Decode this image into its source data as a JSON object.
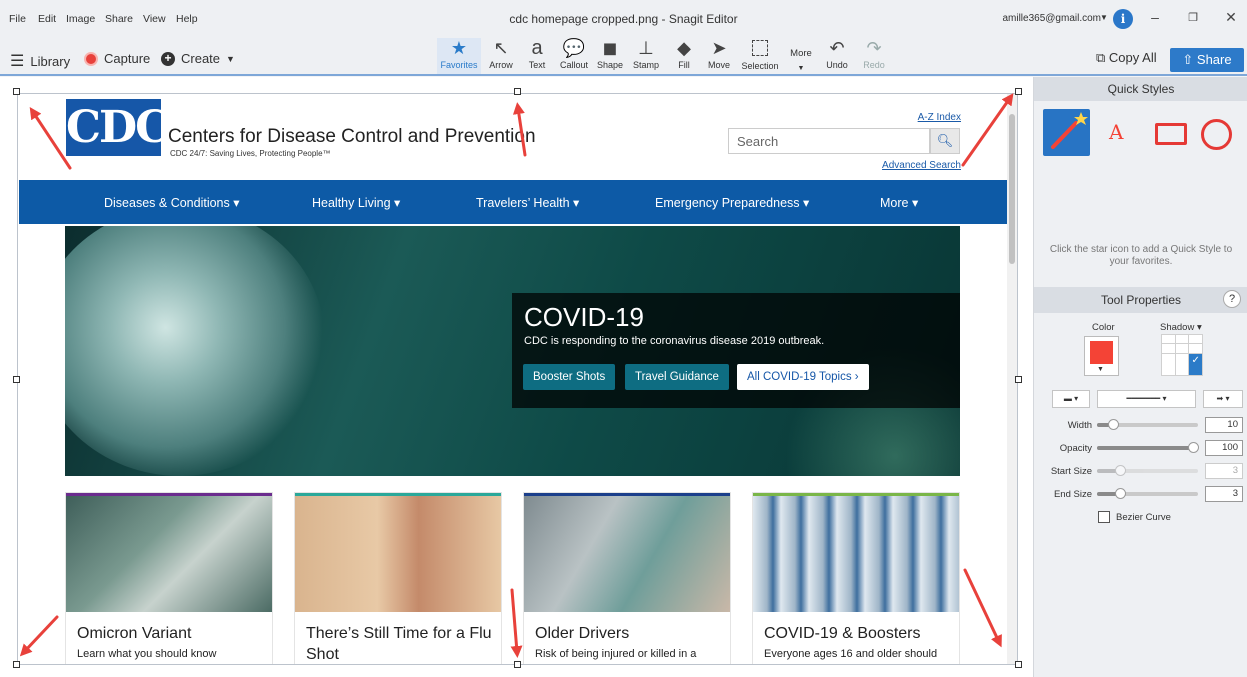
{
  "menu": [
    "File",
    "Edit",
    "Image",
    "Share",
    "View",
    "Help"
  ],
  "window_title": "cdc homepage cropped.png - Snagit Editor",
  "account": "amille365@gmail.com",
  "toolbar": {
    "library": "Library",
    "capture": "Capture",
    "create": "Create",
    "tools": [
      "Favorites",
      "Arrow",
      "Text",
      "Callout",
      "Shape",
      "Stamp",
      "Fill",
      "Move",
      "Selection",
      "More",
      "Undo",
      "Redo"
    ],
    "copy_all": "Copy All",
    "share": "Share"
  },
  "webpage": {
    "logo": "CDC",
    "title": "Centers for Disease Control and Prevention",
    "tagline": "CDC 24/7: Saving Lives, Protecting People™",
    "az_index": "A-Z Index",
    "search_placeholder": "Search",
    "advanced_search": "Advanced Search",
    "nav": [
      "Diseases & Conditions ▾",
      "Healthy Living ▾",
      "Travelers’ Health ▾",
      "Emergency Preparedness ▾",
      "More ▾"
    ],
    "hero": {
      "title": "COVID-19",
      "subtitle": "CDC is responding to the coronavirus disease 2019 outbreak.",
      "buttons": [
        "Booster Shots",
        "Travel Guidance",
        "All COVID-19 Topics ›"
      ]
    },
    "cards": [
      {
        "title": "Omicron Variant",
        "desc": "Learn what you should know",
        "color": "#6b2c8e"
      },
      {
        "title": "There’s Still Time for a Flu",
        "desc": "Shot",
        "color": "#2aa89a"
      },
      {
        "title": "Older Drivers",
        "desc": "Risk of being injured or killed in a",
        "color": "#1b3f8b"
      },
      {
        "title": "COVID-19 & Boosters",
        "desc": "Everyone ages 16 and older should",
        "color": "#7ab648"
      }
    ]
  },
  "panel": {
    "quick_styles": "Quick Styles",
    "hint": "Click the star icon to add a Quick Style to your favorites.",
    "tool_properties": "Tool Properties",
    "help": "?",
    "color_label": "Color",
    "shadow_label": "Shadow ▾",
    "selected_color": "#f44336",
    "properties": [
      {
        "label": "Width",
        "value": "10",
        "fraction": 0.12
      },
      {
        "label": "Opacity",
        "value": "100",
        "fraction": 1.0
      },
      {
        "label": "Start Size",
        "value": "3",
        "fraction": 0.2
      },
      {
        "label": "End Size",
        "value": "3",
        "fraction": 0.2
      }
    ],
    "bezier": "Bezier Curve"
  },
  "accent_color": "#2d7ac9",
  "annotation_color": "#e8413b"
}
